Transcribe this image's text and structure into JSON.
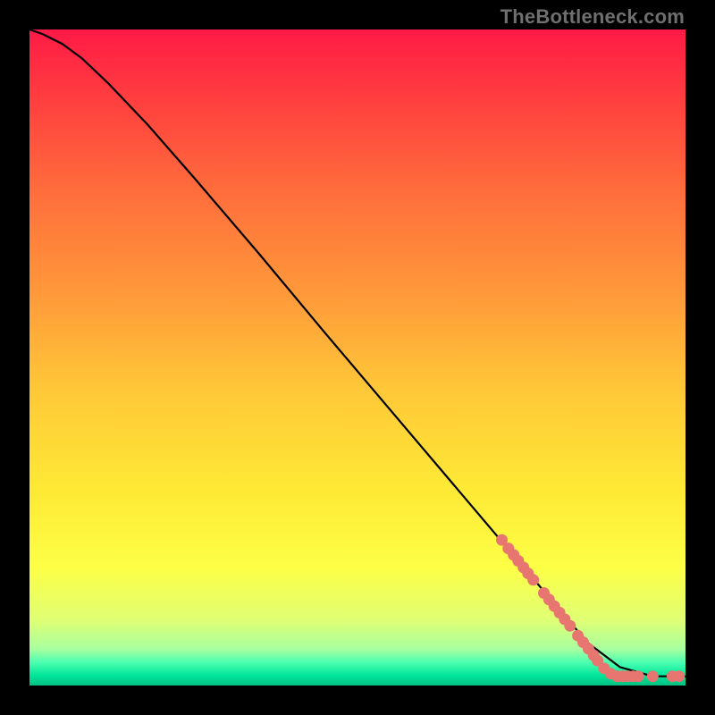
{
  "watermark": "TheBottleneck.com",
  "chart_data": {
    "type": "line",
    "title": "",
    "xlabel": "",
    "ylabel": "",
    "xlim": [
      0,
      100
    ],
    "ylim": [
      0,
      100
    ],
    "grid": false,
    "background_gradient_stops": [
      {
        "pos": 0.0,
        "color": "#ff1a46"
      },
      {
        "pos": 0.1,
        "color": "#ff3c3f"
      },
      {
        "pos": 0.25,
        "color": "#ff6e3c"
      },
      {
        "pos": 0.4,
        "color": "#ff983a"
      },
      {
        "pos": 0.55,
        "color": "#ffc838"
      },
      {
        "pos": 0.7,
        "color": "#fee935"
      },
      {
        "pos": 0.82,
        "color": "#fdff46"
      },
      {
        "pos": 0.9,
        "color": "#e0ff74"
      },
      {
        "pos": 0.945,
        "color": "#a7ffa0"
      },
      {
        "pos": 0.965,
        "color": "#4affb0"
      },
      {
        "pos": 0.985,
        "color": "#00e59a"
      },
      {
        "pos": 1.0,
        "color": "#00c082"
      }
    ],
    "series": [
      {
        "name": "main-curve",
        "type": "line",
        "color": "#000000",
        "x": [
          0.0,
          2.0,
          5.0,
          8.0,
          12.0,
          18.0,
          25.0,
          35.0,
          45.0,
          55.0,
          65.0,
          75.0,
          85.0,
          90.0,
          95.0,
          100.0
        ],
        "y": [
          100.0,
          99.3,
          97.8,
          95.6,
          91.8,
          85.5,
          77.5,
          65.8,
          53.8,
          42.0,
          30.2,
          18.4,
          6.6,
          2.8,
          1.4,
          1.4
        ]
      },
      {
        "name": "highlight-points",
        "type": "scatter",
        "color": "#e77570",
        "radius_px": 6.5,
        "points": [
          {
            "x": 72.0,
            "y": 22.2
          },
          {
            "x": 73.0,
            "y": 20.9
          },
          {
            "x": 73.8,
            "y": 19.9
          },
          {
            "x": 74.5,
            "y": 19.0
          },
          {
            "x": 75.3,
            "y": 18.0
          },
          {
            "x": 76.0,
            "y": 17.1
          },
          {
            "x": 76.8,
            "y": 16.1
          },
          {
            "x": 78.4,
            "y": 14.1
          },
          {
            "x": 79.2,
            "y": 13.1
          },
          {
            "x": 80.0,
            "y": 12.1
          },
          {
            "x": 80.8,
            "y": 11.1
          },
          {
            "x": 81.6,
            "y": 10.1
          },
          {
            "x": 82.4,
            "y": 9.1
          },
          {
            "x": 83.6,
            "y": 7.6
          },
          {
            "x": 84.4,
            "y": 6.6
          },
          {
            "x": 85.2,
            "y": 5.6
          },
          {
            "x": 86.0,
            "y": 4.6
          },
          {
            "x": 86.6,
            "y": 3.8
          },
          {
            "x": 87.6,
            "y": 2.6
          },
          {
            "x": 88.6,
            "y": 1.8
          },
          {
            "x": 89.6,
            "y": 1.4
          },
          {
            "x": 90.4,
            "y": 1.4
          },
          {
            "x": 91.2,
            "y": 1.4
          },
          {
            "x": 92.0,
            "y": 1.4
          },
          {
            "x": 92.8,
            "y": 1.4
          },
          {
            "x": 95.0,
            "y": 1.4
          },
          {
            "x": 98.0,
            "y": 1.4
          },
          {
            "x": 99.0,
            "y": 1.4
          }
        ]
      }
    ]
  }
}
